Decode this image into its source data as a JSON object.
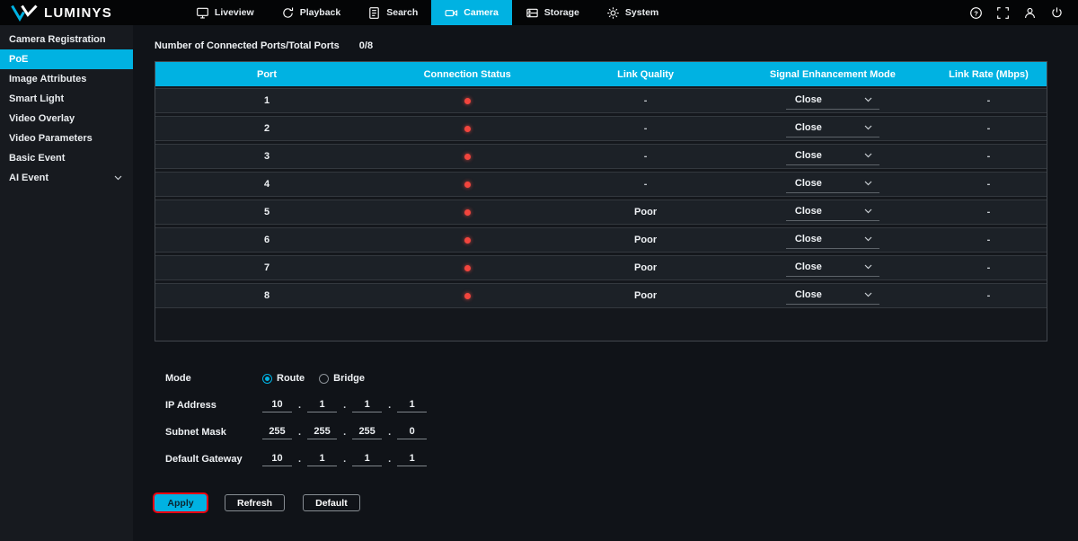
{
  "colors": {
    "accent": "#00B2E2",
    "status_red": "#F2453D",
    "highlight_red": "#EC0010"
  },
  "topbar": {
    "brand": "LUMINYS",
    "nav": [
      {
        "label": "Liveview",
        "active": false
      },
      {
        "label": "Playback",
        "active": false
      },
      {
        "label": "Search",
        "active": false
      },
      {
        "label": "Camera",
        "active": true
      },
      {
        "label": "Storage",
        "active": false
      },
      {
        "label": "System",
        "active": false
      }
    ],
    "icons": [
      "help-icon",
      "screen-capture-icon",
      "user-icon",
      "power-icon"
    ]
  },
  "sidebar": {
    "items": [
      {
        "label": "Camera Registration",
        "active": false,
        "expandable": false
      },
      {
        "label": "PoE",
        "active": true,
        "expandable": false
      },
      {
        "label": "Image Attributes",
        "active": false,
        "expandable": false
      },
      {
        "label": "Smart Light",
        "active": false,
        "expandable": false
      },
      {
        "label": "Video Overlay",
        "active": false,
        "expandable": false
      },
      {
        "label": "Video Parameters",
        "active": false,
        "expandable": false
      },
      {
        "label": "Basic Event",
        "active": false,
        "expandable": false
      },
      {
        "label": "AI Event",
        "active": false,
        "expandable": true
      }
    ]
  },
  "main": {
    "ports_label": "Number of Connected Ports/Total Ports",
    "ports_value": "0/8",
    "table": {
      "columns": [
        "Port",
        "Connection Status",
        "Link Quality",
        "Signal Enhancement Mode",
        "Link Rate (Mbps)"
      ],
      "rows": [
        {
          "port": "1",
          "connection_status": "disconnected",
          "link_quality": "-",
          "signal_mode": "Close",
          "link_rate": "-"
        },
        {
          "port": "2",
          "connection_status": "disconnected",
          "link_quality": "-",
          "signal_mode": "Close",
          "link_rate": "-"
        },
        {
          "port": "3",
          "connection_status": "disconnected",
          "link_quality": "-",
          "signal_mode": "Close",
          "link_rate": "-"
        },
        {
          "port": "4",
          "connection_status": "disconnected",
          "link_quality": "-",
          "signal_mode": "Close",
          "link_rate": "-"
        },
        {
          "port": "5",
          "connection_status": "disconnected",
          "link_quality": "Poor",
          "signal_mode": "Close",
          "link_rate": "-"
        },
        {
          "port": "6",
          "connection_status": "disconnected",
          "link_quality": "Poor",
          "signal_mode": "Close",
          "link_rate": "-"
        },
        {
          "port": "7",
          "connection_status": "disconnected",
          "link_quality": "Poor",
          "signal_mode": "Close",
          "link_rate": "-"
        },
        {
          "port": "8",
          "connection_status": "disconnected",
          "link_quality": "Poor",
          "signal_mode": "Close",
          "link_rate": "-"
        }
      ]
    },
    "mode": {
      "label": "Mode",
      "options": [
        {
          "label": "Route",
          "selected": true
        },
        {
          "label": "Bridge",
          "selected": false
        }
      ]
    },
    "ip_fields": [
      {
        "label": "IP Address",
        "octets": [
          "10",
          "1",
          "1",
          "1"
        ]
      },
      {
        "label": "Subnet Mask",
        "octets": [
          "255",
          "255",
          "255",
          "0"
        ]
      },
      {
        "label": "Default Gateway",
        "octets": [
          "10",
          "1",
          "1",
          "1"
        ]
      }
    ],
    "buttons": [
      {
        "label": "Apply",
        "primary": true,
        "highlighted": true
      },
      {
        "label": "Refresh",
        "primary": false,
        "highlighted": false
      },
      {
        "label": "Default",
        "primary": false,
        "highlighted": false
      }
    ]
  }
}
